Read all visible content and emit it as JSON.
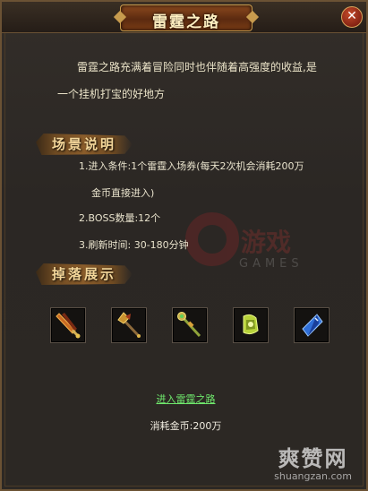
{
  "window": {
    "title": "雷霆之路",
    "close_glyph": "✕"
  },
  "description": {
    "line1": "雷霆之路充满着冒险同时也伴随着高强度的收益,是",
    "line2": "一个挂机打宝的好地方"
  },
  "scene_section": {
    "label": "场景说明",
    "rules": [
      "1.进入条件:1个雷霆入场券(每天2次机会消耗200万",
      "金币直接进入)",
      "2.BOSS数量:12个",
      "3.刷新时间: 30-180分钟"
    ]
  },
  "drop_section": {
    "label": "掉落展示",
    "items": [
      {
        "icon": "sword-icon"
      },
      {
        "icon": "axe-icon"
      },
      {
        "icon": "staff-icon"
      },
      {
        "icon": "gauntlet-icon"
      },
      {
        "icon": "gem-icon"
      }
    ]
  },
  "enter_link": "进入雷霆之路",
  "cost_text": "消耗金币:200万",
  "watermark": {
    "logo_text": "游戏",
    "logo_sub": "GAMES",
    "site_name": "爽赞网",
    "site_url": "shuangzan.com"
  },
  "colors": {
    "link_green": "#6fe86c",
    "title_gold": "#f4d79a",
    "frame_brown": "#6b5234"
  }
}
